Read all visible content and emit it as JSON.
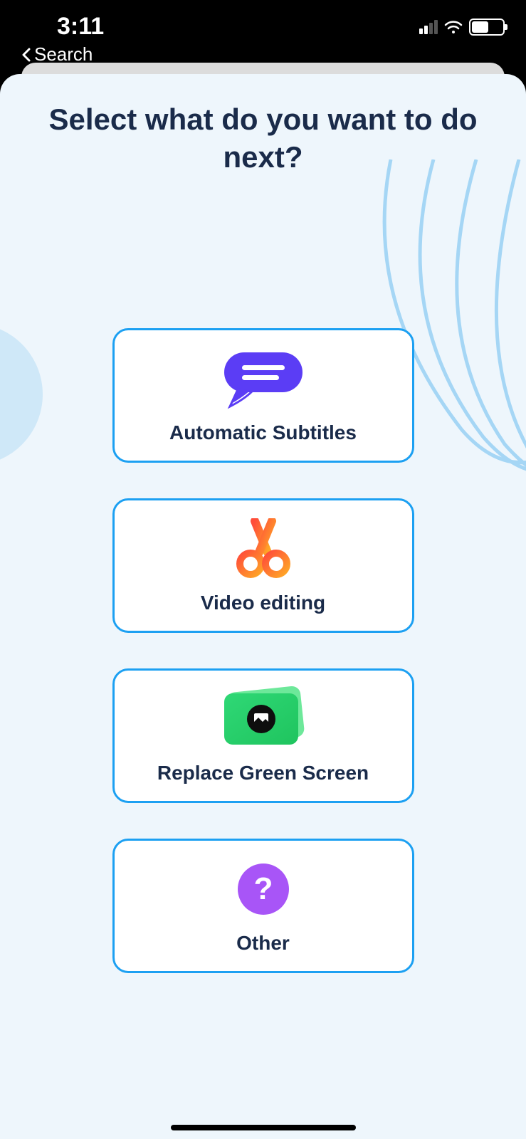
{
  "statusBar": {
    "time": "3:11",
    "backLabel": "Search"
  },
  "page": {
    "title": "Select what do you want to do next?"
  },
  "options": [
    {
      "label": "Automatic Subtitles",
      "iconName": "speech-bubble-icon"
    },
    {
      "label": "Video editing",
      "iconName": "scissors-icon"
    },
    {
      "label": "Replace Green Screen",
      "iconName": "green-screen-icon"
    },
    {
      "label": "Other",
      "iconName": "question-icon"
    }
  ]
}
